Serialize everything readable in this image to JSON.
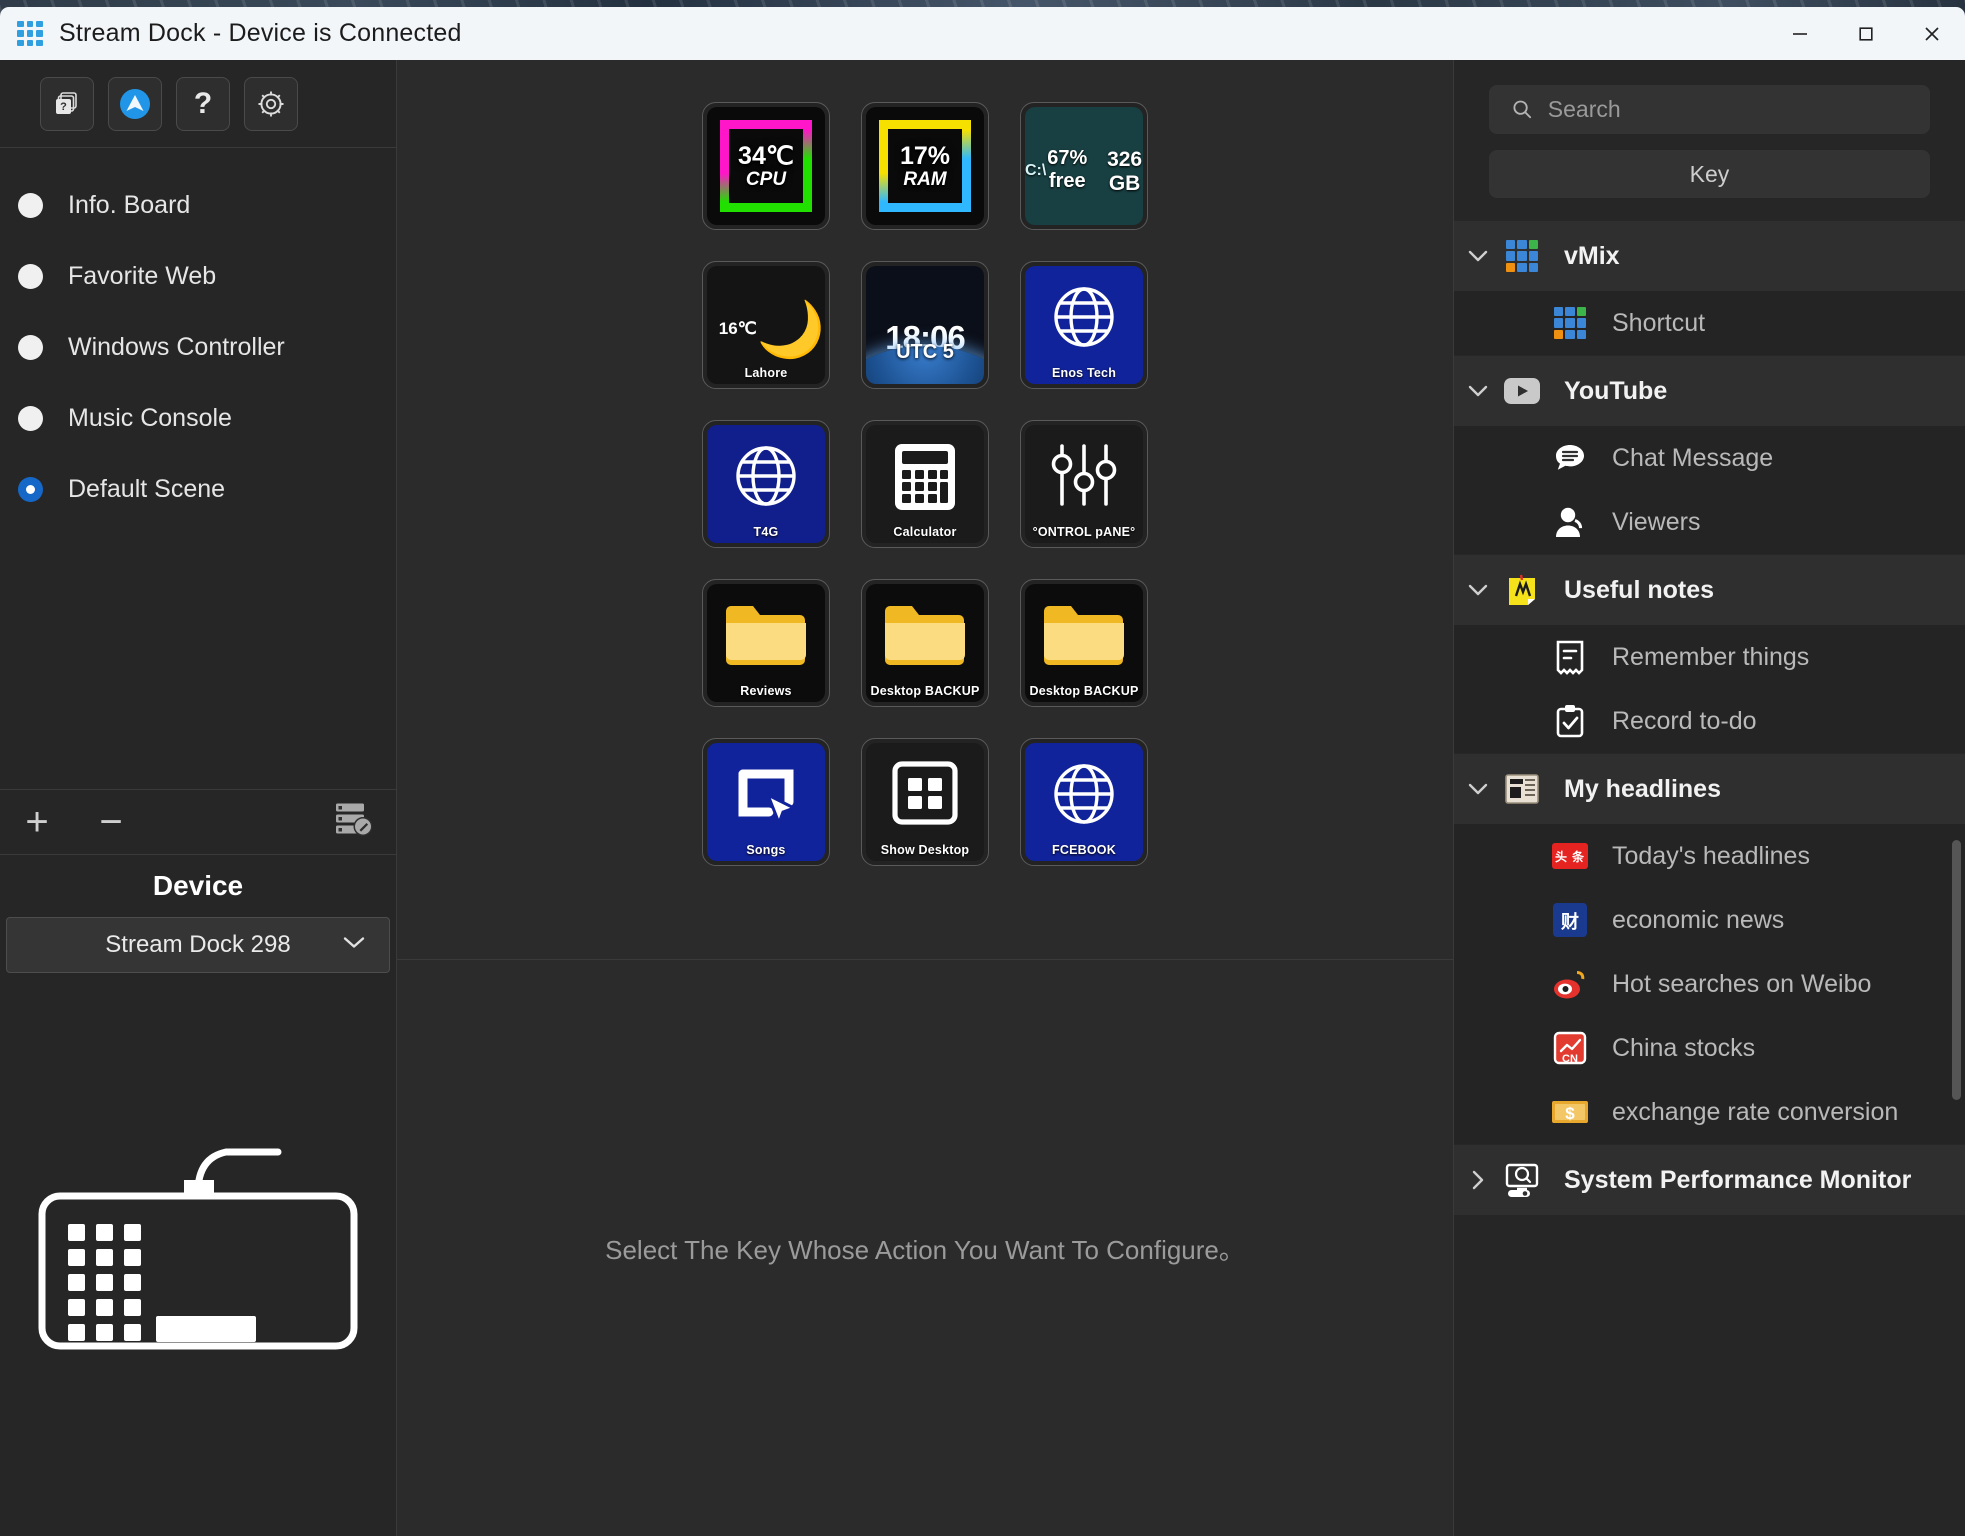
{
  "window": {
    "title": "Stream Dock - Device is Connected",
    "app_icon": "grid-app-icon",
    "minimize_label": "Minimize",
    "maximize_label": "Maximize",
    "close_label": "Close"
  },
  "toolbar": {
    "buttons": [
      {
        "name": "copy-pages-button",
        "icon": "copy-pages-icon",
        "tooltip": "Pages"
      },
      {
        "name": "profile-button",
        "icon": "profile-avatar-icon",
        "tooltip": "Account"
      },
      {
        "name": "help-button",
        "icon": "question-mark-icon",
        "tooltip": "Help",
        "glyph": "?"
      },
      {
        "name": "settings-button",
        "icon": "gear-icon",
        "tooltip": "Settings"
      }
    ]
  },
  "sidebar": {
    "scenes": [
      {
        "label": "Info. Board",
        "selected": false
      },
      {
        "label": "Favorite Web",
        "selected": false
      },
      {
        "label": "Windows Controller",
        "selected": false
      },
      {
        "label": "Music Console",
        "selected": false
      },
      {
        "label": "Default Scene",
        "selected": true
      }
    ],
    "add_label": "+",
    "remove_label": "−",
    "edit_icon": "edit-list-icon",
    "device_heading": "Device",
    "device_selected": "Stream Dock 298",
    "device_chevron": "chevron-down-icon",
    "device_illustration": "keyboard-icon"
  },
  "main": {
    "hint": "Select The Key Whose Action You Want To Configure。",
    "keys": [
      {
        "type": "neon-cpu",
        "value": "34℃",
        "sub": "CPU",
        "caption": ""
      },
      {
        "type": "neon-ram",
        "value": "17%",
        "sub": "RAM",
        "caption": ""
      },
      {
        "type": "disk",
        "drive": "C:\\",
        "percent_label": "67% free",
        "fill_percent": 67,
        "size": "326 GB",
        "caption": ""
      },
      {
        "type": "weather",
        "temp": "16℃",
        "icon": "crescent-moon-icon",
        "caption": "Lahore"
      },
      {
        "type": "clock",
        "time": "18:06",
        "zone": "UTC 5",
        "caption": ""
      },
      {
        "type": "globe-blue",
        "icon": "globe-icon",
        "caption": "Enos Tech"
      },
      {
        "type": "globe-blue",
        "icon": "globe-icon",
        "caption": "T4G"
      },
      {
        "type": "calculator",
        "icon": "calculator-icon",
        "caption": "Calculator"
      },
      {
        "type": "sliders",
        "icon": "sliders-icon",
        "caption": "°ONTROL pANE°"
      },
      {
        "type": "folder",
        "icon": "folder-icon",
        "caption": "Reviews"
      },
      {
        "type": "folder",
        "icon": "folder-icon",
        "caption": "Desktop BACKUP"
      },
      {
        "type": "folder",
        "icon": "folder-icon",
        "caption": "Desktop BACKUP"
      },
      {
        "type": "cursor",
        "icon": "cursor-select-icon",
        "caption": "Songs"
      },
      {
        "type": "showdesk",
        "icon": "show-desktop-icon",
        "caption": "Show Desktop"
      },
      {
        "type": "globe-blue",
        "icon": "globe-icon",
        "caption": "FCEBOOK"
      }
    ]
  },
  "right": {
    "search_placeholder": "Search",
    "search_value": "",
    "search_icon": "search-icon",
    "key_tab_label": "Key",
    "groups": [
      {
        "label": "vMix",
        "icon": "vmix-grid-icon",
        "expanded": true,
        "chevron": "chevron-down-icon",
        "items": [
          {
            "label": "Shortcut",
            "icon": "vmix-grid-icon"
          }
        ]
      },
      {
        "label": "YouTube",
        "icon": "youtube-play-icon",
        "expanded": true,
        "chevron": "chevron-down-icon",
        "items": [
          {
            "label": "Chat Message",
            "icon": "chat-bubble-icon"
          },
          {
            "label": "Viewers",
            "icon": "user-icon"
          }
        ]
      },
      {
        "label": "Useful notes",
        "icon": "sticky-note-icon",
        "expanded": true,
        "chevron": "chevron-down-icon",
        "items": [
          {
            "label": "Remember things",
            "icon": "note-lines-icon"
          },
          {
            "label": "Record to-do",
            "icon": "clipboard-check-icon"
          }
        ]
      },
      {
        "label": "My headlines",
        "icon": "newspaper-icon",
        "expanded": true,
        "chevron": "chevron-down-icon",
        "items": [
          {
            "label": "Today's headlines",
            "icon": "toutiao-icon"
          },
          {
            "label": "economic news",
            "icon": "economic-news-icon"
          },
          {
            "label": "Hot searches on Weibo",
            "icon": "weibo-icon"
          },
          {
            "label": "China stocks",
            "icon": "china-stocks-icon"
          },
          {
            "label": "exchange rate conversion",
            "icon": "dollar-bill-icon"
          }
        ]
      },
      {
        "label": "System Performance Monitor",
        "icon": "monitor-search-icon",
        "expanded": false,
        "chevron": "chevron-right-icon",
        "items": []
      }
    ]
  },
  "colors": {
    "accent": "#1668c8",
    "titlebar_bg": "#f3f6f9",
    "panel_bg": "#262626",
    "canvas_bg": "#2b2b2b",
    "key_blue": "#11239b",
    "folder_yellow": "#f5c842"
  }
}
